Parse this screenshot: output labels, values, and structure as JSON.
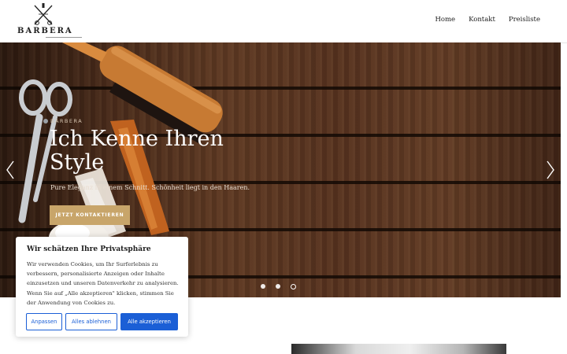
{
  "header": {
    "logo_text": "BARBERA",
    "nav": [
      {
        "label": "Home"
      },
      {
        "label": "Kontakt"
      },
      {
        "label": "Preisliste"
      }
    ]
  },
  "hero": {
    "eyebrow": "BARBERA",
    "title": "Ich Kenne Ihren Style",
    "subtitle": "Pure Eleganz in einem Schnitt. Schönheit liegt in den Haaren.",
    "cta_label": "JETZT KONTAKTIEREN",
    "slides_count": 3,
    "active_slide": 3
  },
  "cookie": {
    "title": "Wir schätzen Ihre Privatsphäre",
    "text": "Wir verwenden Cookies, um Ihr Surferlebnis zu verbessern, personalisierte Anzeigen oder Inhalte einzusetzen und unseren Datenverkehr zu analysieren. Wenn Sie auf „Alle akzeptieren\" klicken, stimmen Sie der Anwendung von Cookies zu.",
    "buttons": {
      "customize": "Anpassen",
      "reject": "Alles ablehnen",
      "accept": "Alle akzeptieren"
    }
  },
  "colors": {
    "accent_gold": "#c8a56a",
    "cookie_blue": "#1b5fd6"
  }
}
